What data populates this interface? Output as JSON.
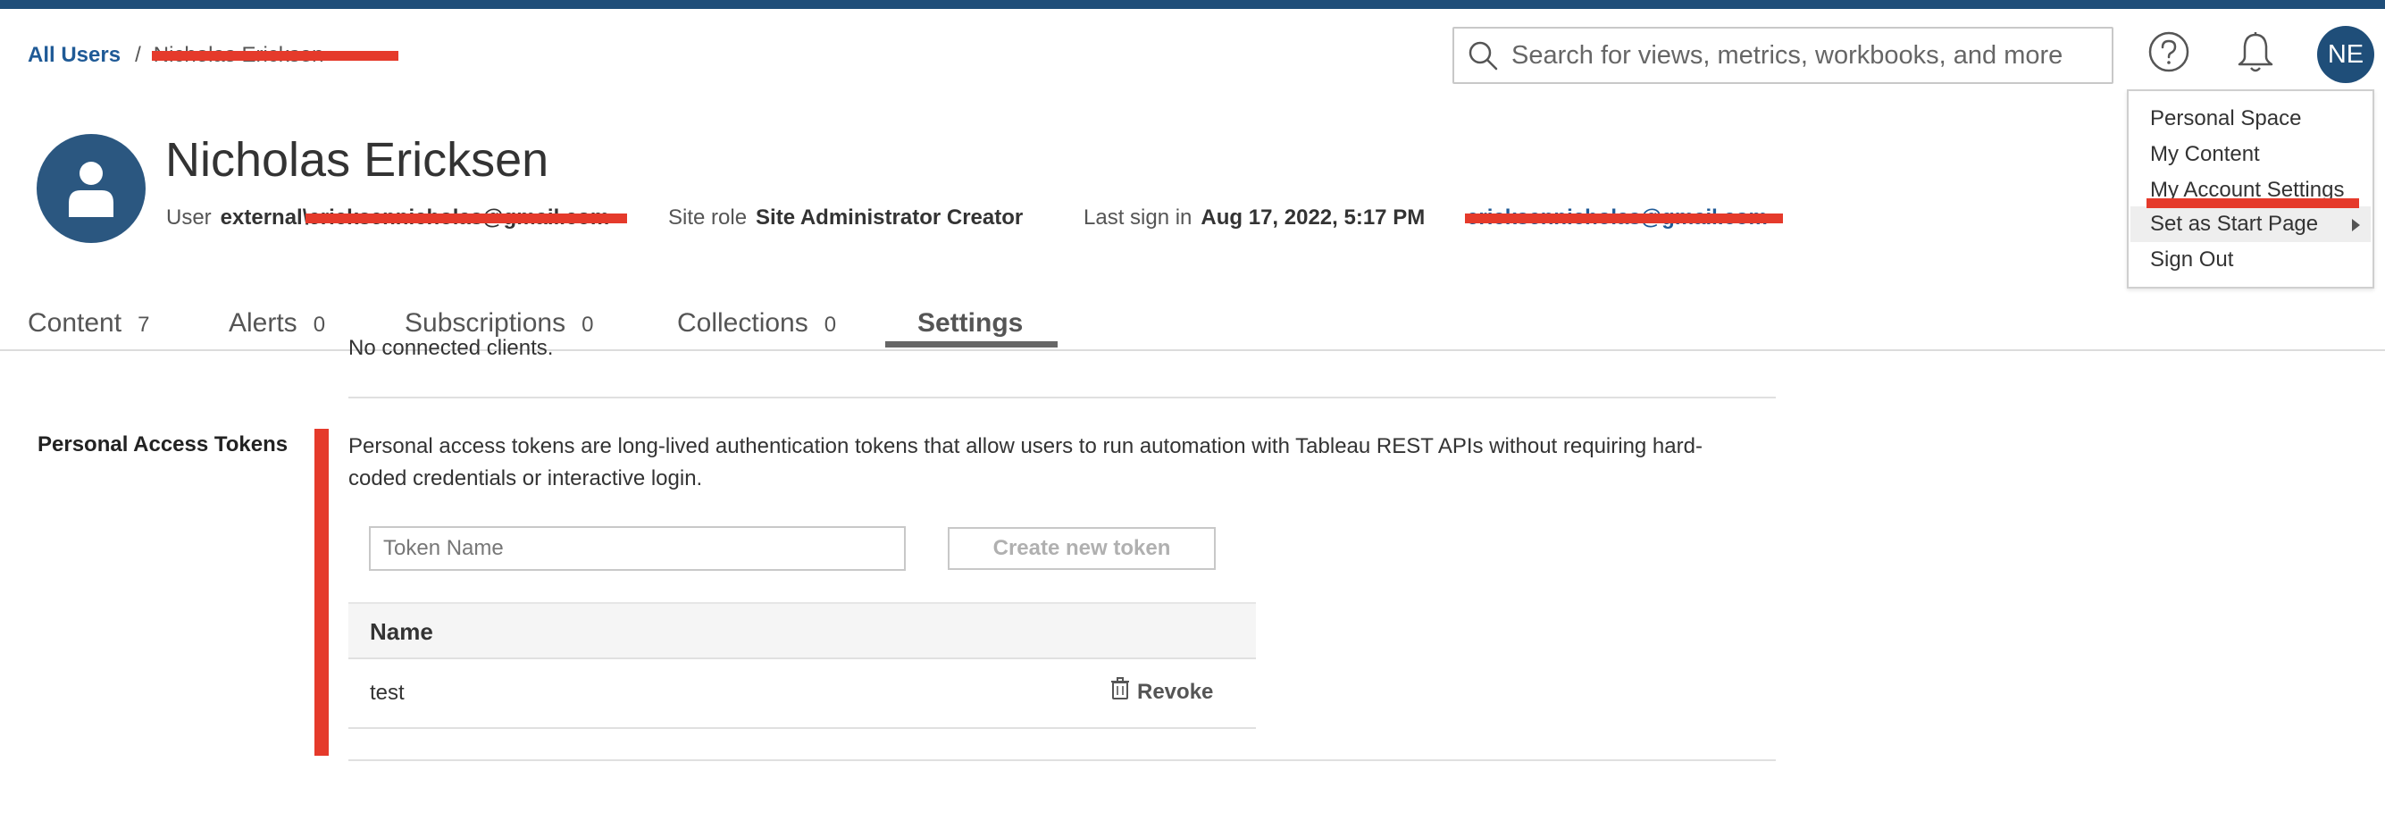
{
  "breadcrumb": {
    "root": "All Users",
    "separator": "/",
    "current": "Nicholas Ericksen"
  },
  "search": {
    "placeholder": "Search for views, metrics, workbooks, and more",
    "icon": "search-icon"
  },
  "header_icons": {
    "help": "question-circle-icon",
    "notifications": "bell-icon",
    "avatar_initials": "NE"
  },
  "user_menu": {
    "items": [
      {
        "label": "Personal Space"
      },
      {
        "label": "My Content"
      },
      {
        "label": "My Account Settings"
      },
      {
        "label": "Set as Start Page",
        "has_submenu": true
      },
      {
        "label": "Sign Out"
      }
    ]
  },
  "profile": {
    "name": "Nicholas Ericksen",
    "user_label": "User",
    "user_value": "external\\ericksennicholas@gmail.com",
    "site_role_label": "Site role",
    "site_role_value": "Site Administrator Creator",
    "last_sign_in_label": "Last sign in",
    "last_sign_in_value": "Aug 17, 2022, 5:17 PM",
    "email": "ericksennicholas@gmail.com"
  },
  "tabs": [
    {
      "label": "Content",
      "count": "7"
    },
    {
      "label": "Alerts",
      "count": "0"
    },
    {
      "label": "Subscriptions",
      "count": "0"
    },
    {
      "label": "Collections",
      "count": "0"
    },
    {
      "label": "Settings",
      "count": "",
      "active": true
    }
  ],
  "connected_clients": {
    "text": "No connected clients."
  },
  "personal_access_tokens": {
    "label": "Personal Access Tokens",
    "description": "Personal access tokens are long-lived authentication tokens that allow users to run automation with Tableau REST APIs without requiring hard-coded credentials or interactive login.",
    "input_placeholder": "Token Name",
    "create_button": "Create new token",
    "table_header_name": "Name",
    "tokens": [
      {
        "name": "test",
        "action": "Revoke"
      }
    ]
  },
  "colors": {
    "brand_bar": "#1f4e79",
    "link": "#1f5a96",
    "annotation_red": "#e53a2b"
  }
}
